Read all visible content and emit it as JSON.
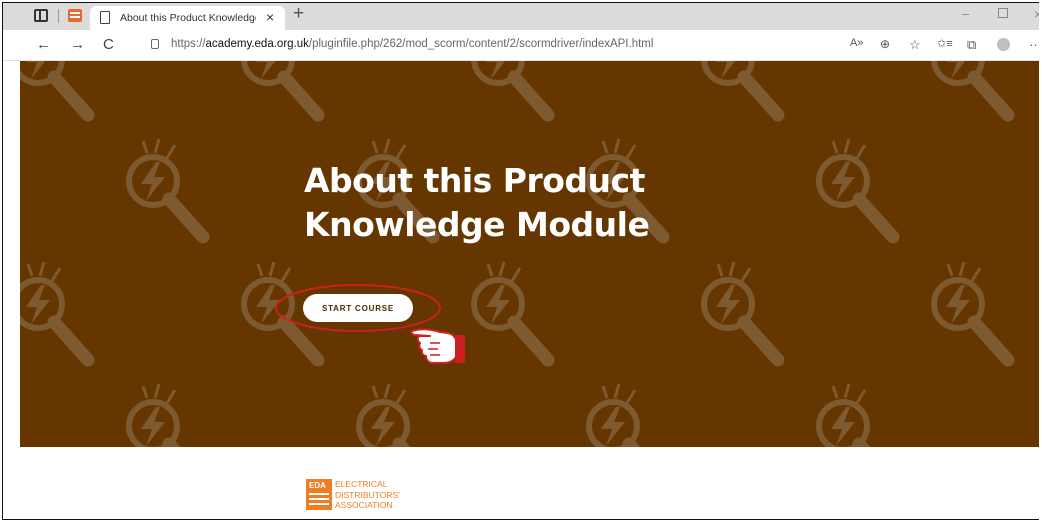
{
  "browser": {
    "tab_title": "About this Product Knowledge M",
    "tab_close": "×",
    "new_tab": "+",
    "url_prefix": "https://",
    "url_host": "academy.eda.org.uk",
    "url_path": "/pluginfile.php/262/mod_scorm/content/2/scormdriver/indexAPI.html",
    "nav_back": "←",
    "nav_forward": "→",
    "nav_reload": "C",
    "read_aloud": "A»",
    "zoom": "⊕",
    "favorite": "☆",
    "favorites": "✩≡",
    "collections": "⧉",
    "more": "…",
    "win_min": "–",
    "win_close": "×"
  },
  "hero": {
    "title_line1": "About this Product",
    "title_line2": "Knowledge Module",
    "button_label": "START COURSE",
    "bg_color": "#663600",
    "pattern_color": "#7d5a2f"
  },
  "logo": {
    "mark": "EDA",
    "line1": "ELECTRICAL",
    "line2": "DISTRIBUTORS'",
    "line3": "ASSOCIATION",
    "color": "#ef7d22"
  },
  "annotation": {
    "highlight_color": "#cc1f1f"
  }
}
